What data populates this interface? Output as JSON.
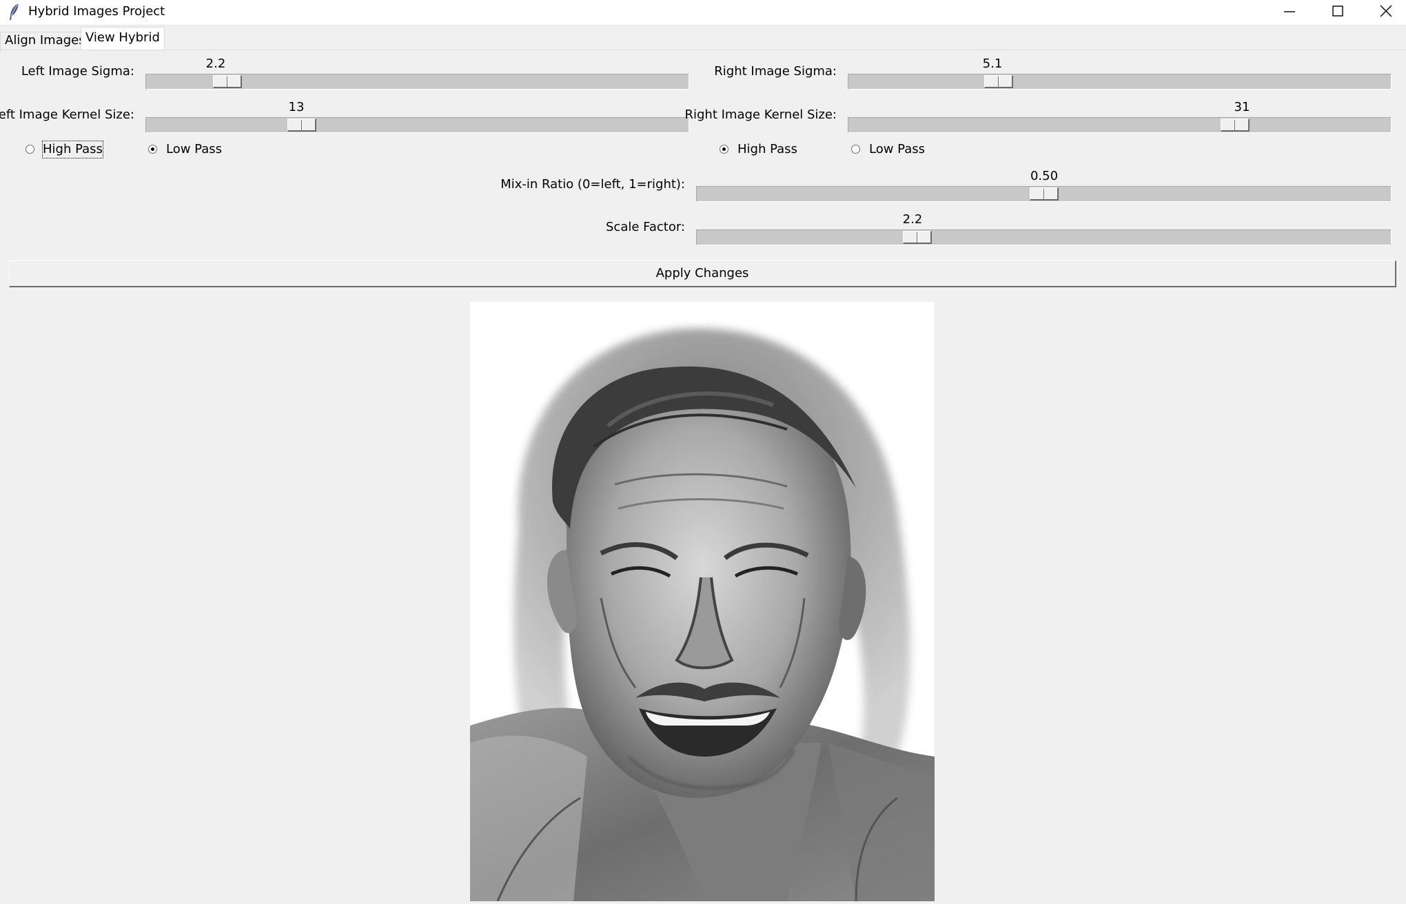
{
  "window": {
    "title": "Hybrid Images Project",
    "controls": [
      "minimize",
      "maximize",
      "close"
    ]
  },
  "tabs": [
    {
      "label": "Align Images",
      "selected": false
    },
    {
      "label": "View Hybrid",
      "selected": true
    }
  ],
  "left": {
    "sigma": {
      "label": "Left Image Sigma:",
      "value": "2.2",
      "position": 0.13
    },
    "kernel": {
      "label": "Left Image Kernel Size:",
      "value": "13",
      "position": 0.275
    },
    "filter": {
      "high_pass_label": "High Pass",
      "low_pass_label": "Low Pass",
      "selected": "Low Pass"
    }
  },
  "right": {
    "sigma": {
      "label": "Right Image Sigma:",
      "value": "5.1",
      "position": 0.265
    },
    "kernel": {
      "label": "Right Image Kernel Size:",
      "value": "31",
      "position": 0.725
    },
    "filter": {
      "high_pass_label": "High Pass",
      "low_pass_label": "Low Pass",
      "selected": "High Pass"
    }
  },
  "mix": {
    "label": "Mix-in Ratio (0=left, 1=right):",
    "value": "0.50",
    "position": 0.5
  },
  "scale": {
    "label": "Scale Factor:",
    "value": "2.2",
    "position": 0.31
  },
  "apply_label": "Apply Changes",
  "image": {
    "description_icon": "hybrid-face-image"
  },
  "colors": {
    "background": "#f0f0f0",
    "track": "#c8c8c8",
    "image_bg": "#ffffff"
  }
}
